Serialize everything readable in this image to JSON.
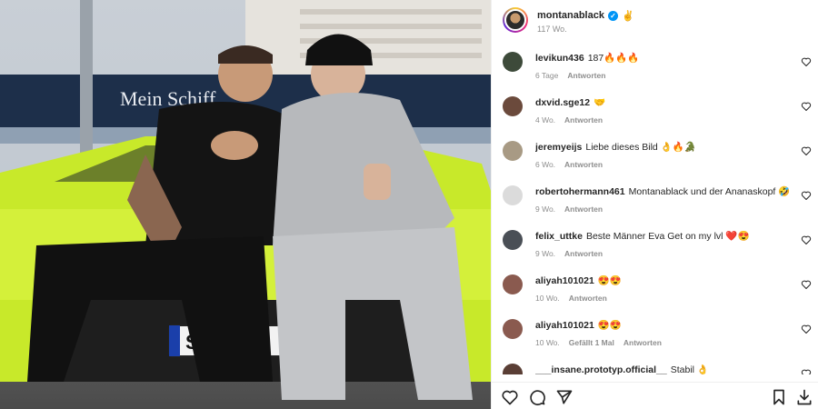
{
  "post": {
    "owner": {
      "username": "montanablack",
      "emoji": "✌",
      "time": "117 Wo."
    }
  },
  "photo": {
    "ship_text": "Mein Schiff",
    "plate_text": "STD",
    "car_color": "#c8e92a"
  },
  "comments": [
    {
      "username": "levikun436",
      "text": "187🔥🔥🔥",
      "time": "6 Tage",
      "likes": "",
      "reply": "Antworten",
      "avatar": "#3d4a3a"
    },
    {
      "username": "dxvid.sge12",
      "text": "🤝",
      "time": "4 Wo.",
      "likes": "",
      "reply": "Antworten",
      "avatar": "#6b4a3c"
    },
    {
      "username": "jeremyeijs",
      "text": "Liebe dieses Bild 👌🔥🐊",
      "time": "6 Wo.",
      "likes": "",
      "reply": "Antworten",
      "avatar": "#a89a84"
    },
    {
      "username": "robertohermann461",
      "text": "Montanablack und der Ananaskopf 🤣",
      "time": "9 Wo.",
      "likes": "",
      "reply": "Antworten",
      "avatar": "#dbdbdb"
    },
    {
      "username": "felix_uttke",
      "text": "Beste Männer Eva Get on my lvl ❤️😍",
      "time": "9 Wo.",
      "likes": "",
      "reply": "Antworten",
      "avatar": "#4a4f56"
    },
    {
      "username": "aliyah101021",
      "text": "😍😍",
      "time": "10 Wo.",
      "likes": "",
      "reply": "Antworten",
      "avatar": "#8a5a4f"
    },
    {
      "username": "aliyah101021",
      "text": "😍😍",
      "time": "10 Wo.",
      "likes": "Gefällt 1 Mal",
      "reply": "Antworten",
      "avatar": "#8a5a4f"
    },
    {
      "username": "___insane.prototyp.official__",
      "text": "Stabil 👌",
      "time": "",
      "likes": "",
      "reply": "",
      "avatar": "#5a3e35"
    }
  ],
  "icons": {
    "like": "heart-icon",
    "comment": "comment-icon",
    "share": "send-icon",
    "save": "bookmark-icon",
    "download": "download-icon"
  },
  "colors": {
    "text": "#262626",
    "muted": "#8e8e8e",
    "verified": "#0095f6"
  }
}
